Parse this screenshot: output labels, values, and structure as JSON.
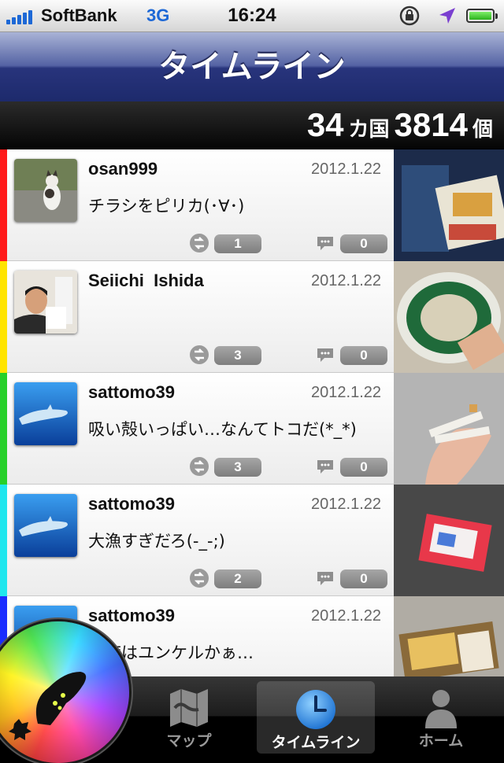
{
  "status_bar": {
    "carrier": "SoftBank",
    "network": "3G",
    "time": "16:24",
    "icons": [
      "signal-icon",
      "rotation-lock-icon",
      "location-icon",
      "battery-icon"
    ]
  },
  "nav": {
    "title": "タイムライン"
  },
  "stats": {
    "countries": "34",
    "countries_unit": "カ国",
    "items": "3814",
    "items_unit": "個"
  },
  "posts": [
    {
      "user": "osan999",
      "date": "2012.1.22",
      "message": "チラシをピリカ(･∀･)",
      "reposts": "1",
      "comments": "0",
      "stripe": "#ff1a1a"
    },
    {
      "user": "Seiichi  Ishida",
      "date": "2012.1.22",
      "message": "",
      "reposts": "3",
      "comments": "0",
      "stripe": "#ffe400"
    },
    {
      "user": "sattomo39",
      "date": "2012.1.22",
      "message": "吸い殻いっぱい…なんてトコだ(*_*)",
      "reposts": "3",
      "comments": "0",
      "stripe": "#27d02a"
    },
    {
      "user": "sattomo39",
      "date": "2012.1.22",
      "message": "大漁すぎだろ(-_-;)",
      "reposts": "2",
      "comments": "0",
      "stripe": "#1fe6ee"
    },
    {
      "user": "sattomo39",
      "date": "2012.1.22",
      "message": "今度はユンケルかぁ…",
      "reposts": "",
      "comments": "",
      "stripe": "#1a2dff"
    }
  ],
  "tabs": [
    {
      "label": "マップ",
      "icon": "map-icon"
    },
    {
      "label": "タイムライン",
      "icon": "clock-icon"
    },
    {
      "label": "ホーム",
      "icon": "person-icon"
    }
  ]
}
